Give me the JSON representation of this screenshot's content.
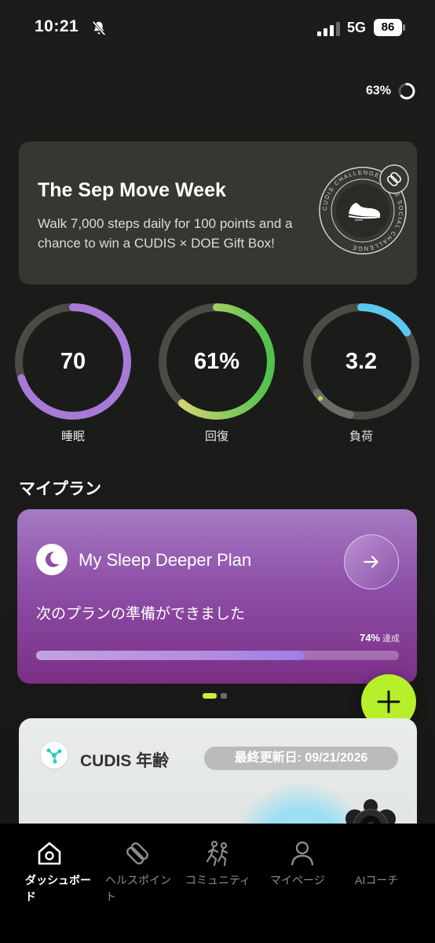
{
  "status_bar": {
    "time": "10:21",
    "network": "5G",
    "battery": "86"
  },
  "top_progress": {
    "label": "63%",
    "value": 0.63
  },
  "challenge": {
    "title": "The Sep Move Week",
    "description": "Walk 7,000 steps daily for 100 points and a chance to win a CUDIS × DOE Gift Box!",
    "badge_icon": "sneaker-icon",
    "badge_text": "CUDIS CHALLENGE CUDIS SOCIAL CHALLENGE"
  },
  "rings": [
    {
      "value": "70",
      "label": "睡眠",
      "fraction": 0.7,
      "color": "#a67ad6"
    },
    {
      "value": "61%",
      "label": "回復",
      "fraction": 0.61,
      "color": "#8fd84e"
    },
    {
      "value": "3.2",
      "label": "負荷",
      "fraction": 0.16,
      "color": "#5ac8f0"
    }
  ],
  "my_plan": {
    "section_title": "マイプラン",
    "plan_title": "My Sleep Deeper Plan",
    "status": "次のプランの準備ができました",
    "percent": "74%",
    "percent_suffix": "達成",
    "progress": 0.74
  },
  "age_card": {
    "title": "CUDIS 年齢",
    "updated": "最終更新日: 09/21/2026"
  },
  "tabs": [
    {
      "label": "ダッシュボード",
      "icon": "home-icon",
      "active": true
    },
    {
      "label": "ヘルスポイント",
      "icon": "health-points-icon",
      "active": false
    },
    {
      "label": "コミュニティ",
      "icon": "community-icon",
      "active": false
    },
    {
      "label": "マイページ",
      "icon": "person-icon",
      "active": false
    },
    {
      "label": "AIコーチ",
      "icon": "ai-coach-icon",
      "active": false
    }
  ],
  "colors": {
    "accent": "#b7ef2a",
    "plan_purple": "#8d4ea7",
    "background": "#1c1d1b"
  }
}
